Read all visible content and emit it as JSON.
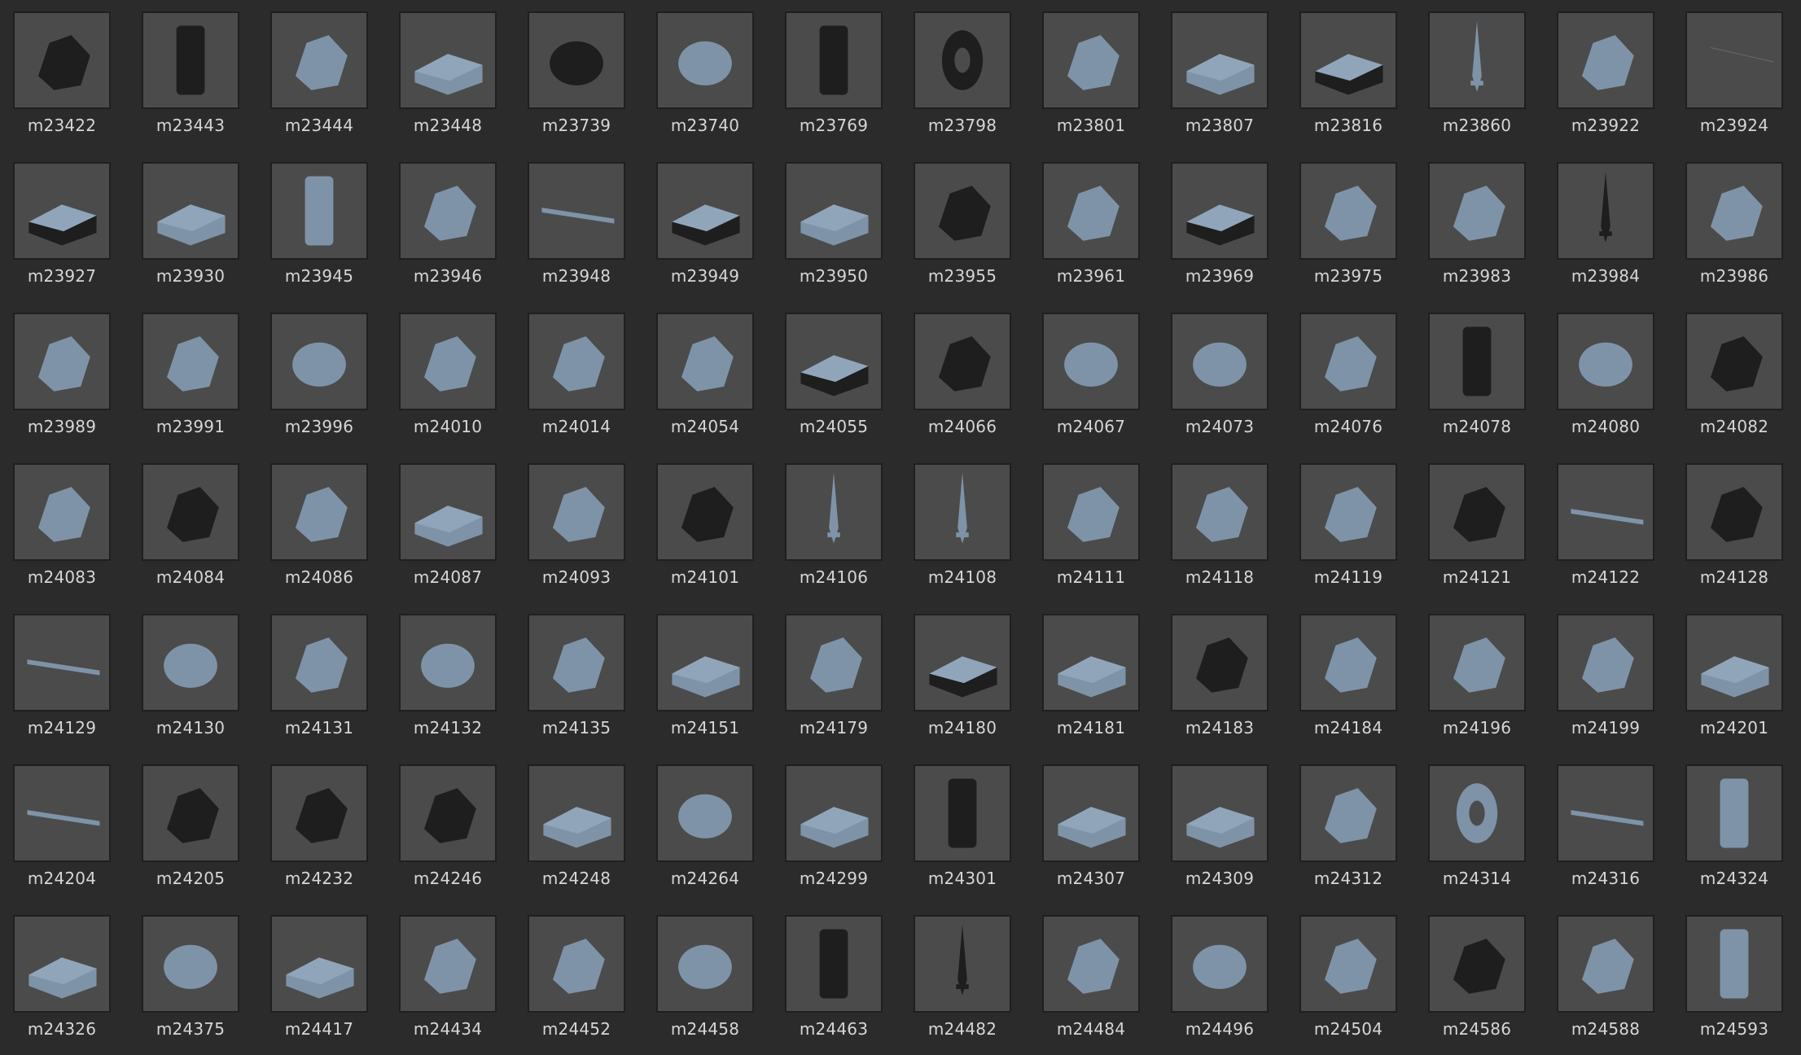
{
  "colors": {
    "background": "#2b2b2b",
    "thumb_bg": "#4b4b4b",
    "label": "#d6d6d6",
    "part_light": "#7f93a8",
    "part_dark": "#1e1e1e"
  },
  "items": [
    {
      "label": "m23422",
      "icon": "pin-connector-icon",
      "tone": "dark"
    },
    {
      "label": "m23443",
      "icon": "clip-holder-icon",
      "tone": "dark"
    },
    {
      "label": "m23444",
      "icon": "frame-bar-icon",
      "tone": "light"
    },
    {
      "label": "m23448",
      "icon": "curved-slope-icon",
      "tone": "light"
    },
    {
      "label": "m23739",
      "icon": "dome-cap-icon",
      "tone": "dark"
    },
    {
      "label": "m23740",
      "icon": "bowl-clip-icon",
      "tone": "light"
    },
    {
      "label": "m23769",
      "icon": "wrench-bar-icon",
      "tone": "dark"
    },
    {
      "label": "m23798",
      "icon": "tire-icon",
      "tone": "dark"
    },
    {
      "label": "m23801",
      "icon": "armor-piece-icon",
      "tone": "light"
    },
    {
      "label": "m23807",
      "icon": "machine-block-icon",
      "tone": "light"
    },
    {
      "label": "m23816",
      "icon": "brick-block-icon",
      "tone": "dark"
    },
    {
      "label": "m23860",
      "icon": "blade-icon",
      "tone": "light"
    },
    {
      "label": "m23922",
      "icon": "clamp-icon",
      "tone": "light"
    },
    {
      "label": "m23924",
      "icon": "empty-thumb-icon",
      "tone": "none"
    },
    {
      "label": "m23927",
      "icon": "vehicle-base-icon",
      "tone": "dark"
    },
    {
      "label": "m23930",
      "icon": "ramp-icon",
      "tone": "light"
    },
    {
      "label": "m23945",
      "icon": "column-icon",
      "tone": "light"
    },
    {
      "label": "m23946",
      "icon": "deer-icon",
      "tone": "light"
    },
    {
      "label": "m23948",
      "icon": "rod-icon",
      "tone": "light"
    },
    {
      "label": "m23949",
      "icon": "slope-brick-icon",
      "tone": "dark"
    },
    {
      "label": "m23950",
      "icon": "seat-icon",
      "tone": "light"
    },
    {
      "label": "m23955",
      "icon": "hair-piece-icon",
      "tone": "dark"
    },
    {
      "label": "m23961",
      "icon": "crane-arm-icon",
      "tone": "light"
    },
    {
      "label": "m23969",
      "icon": "box-corner-icon",
      "tone": "dark"
    },
    {
      "label": "m23975",
      "icon": "castle-wall-icon",
      "tone": "light"
    },
    {
      "label": "m23983",
      "icon": "bracket-icon",
      "tone": "light"
    },
    {
      "label": "m23984",
      "icon": "sword-dark-icon",
      "tone": "dark"
    },
    {
      "label": "m23986",
      "icon": "teapot-icon",
      "tone": "light"
    },
    {
      "label": "m23989",
      "icon": "wing-icon",
      "tone": "light"
    },
    {
      "label": "m23991",
      "icon": "boat-icon",
      "tone": "light"
    },
    {
      "label": "m23996",
      "icon": "rock-stairs-icon",
      "tone": "light"
    },
    {
      "label": "m24010",
      "icon": "mechanical-arm-icon",
      "tone": "light"
    },
    {
      "label": "m24014",
      "icon": "fist-icon",
      "tone": "light"
    },
    {
      "label": "m24054",
      "icon": "door-icon",
      "tone": "light"
    },
    {
      "label": "m24055",
      "icon": "plate-brick-icon",
      "tone": "dark"
    },
    {
      "label": "m24066",
      "icon": "skunk-icon",
      "tone": "dark"
    },
    {
      "label": "m24067",
      "icon": "helmet-round-icon",
      "tone": "light"
    },
    {
      "label": "m24073",
      "icon": "cap-icon",
      "tone": "light"
    },
    {
      "label": "m24076",
      "icon": "shark-icon",
      "tone": "light"
    },
    {
      "label": "m24078",
      "icon": "robot-torso-icon",
      "tone": "dark"
    },
    {
      "label": "m24080",
      "icon": "rock-icon",
      "tone": "light"
    },
    {
      "label": "m24082",
      "icon": "round-sign-icon",
      "tone": "dark"
    },
    {
      "label": "m24083",
      "icon": "dish-stand-icon",
      "tone": "light"
    },
    {
      "label": "m24084",
      "icon": "spiky-ball-icon",
      "tone": "dark"
    },
    {
      "label": "m24086",
      "icon": "net-icon",
      "tone": "light"
    },
    {
      "label": "m24087",
      "icon": "plate-round-icon",
      "tone": "light"
    },
    {
      "label": "m24093",
      "icon": "book-icon",
      "tone": "light"
    },
    {
      "label": "m24101",
      "icon": "chain-arm-icon",
      "tone": "dark"
    },
    {
      "label": "m24106",
      "icon": "sword-icon",
      "tone": "light"
    },
    {
      "label": "m24108",
      "icon": "sword-long-icon",
      "tone": "light"
    },
    {
      "label": "m24111",
      "icon": "pony-icon",
      "tone": "light"
    },
    {
      "label": "m24118",
      "icon": "hook-icon",
      "tone": "light"
    },
    {
      "label": "m24119",
      "icon": "gun-icon",
      "tone": "light"
    },
    {
      "label": "m24121",
      "icon": "track-curve-icon",
      "tone": "dark"
    },
    {
      "label": "m24122",
      "icon": "pipe-connector-icon",
      "tone": "light"
    },
    {
      "label": "m24128",
      "icon": "armor-dark-icon",
      "tone": "dark"
    },
    {
      "label": "m24129",
      "icon": "pipe-clip-icon",
      "tone": "light"
    },
    {
      "label": "m24130",
      "icon": "bowl-icon",
      "tone": "light"
    },
    {
      "label": "m24131",
      "icon": "pawn-icon",
      "tone": "light"
    },
    {
      "label": "m24132",
      "icon": "egg-icon",
      "tone": "light"
    },
    {
      "label": "m24135",
      "icon": "ring-clip-icon",
      "tone": "light"
    },
    {
      "label": "m24151",
      "icon": "wedge-plate-icon",
      "tone": "light"
    },
    {
      "label": "m24179",
      "icon": "cabin-icon",
      "tone": "light"
    },
    {
      "label": "m24180",
      "icon": "duplo-plate-icon",
      "tone": "dark"
    },
    {
      "label": "m24181",
      "icon": "flat-plate-icon",
      "tone": "light"
    },
    {
      "label": "m24183",
      "icon": "bear-icon",
      "tone": "dark"
    },
    {
      "label": "m24184",
      "icon": "tail-icon",
      "tone": "light"
    },
    {
      "label": "m24196",
      "icon": "fish-head-icon",
      "tone": "light"
    },
    {
      "label": "m24199",
      "icon": "lever-icon",
      "tone": "light"
    },
    {
      "label": "m24201",
      "icon": "slope-stud-icon",
      "tone": "light"
    },
    {
      "label": "m24204",
      "icon": "whip-icon",
      "tone": "light"
    },
    {
      "label": "m24205",
      "icon": "animal-dark-icon",
      "tone": "dark"
    },
    {
      "label": "m24232",
      "icon": "cannon-icon",
      "tone": "dark"
    },
    {
      "label": "m24246",
      "icon": "quarter-round-icon",
      "tone": "dark"
    },
    {
      "label": "m24248",
      "icon": "wedge-ramp-icon",
      "tone": "light"
    },
    {
      "label": "m24264",
      "icon": "turtle-icon",
      "tone": "light"
    },
    {
      "label": "m24299",
      "icon": "wing-plate-icon",
      "tone": "light"
    },
    {
      "label": "m24301",
      "icon": "tripod-icon",
      "tone": "dark"
    },
    {
      "label": "m24307",
      "icon": "stud-plate-icon",
      "tone": "light"
    },
    {
      "label": "m24309",
      "icon": "curved-slope-long-icon",
      "tone": "light"
    },
    {
      "label": "m24312",
      "icon": "chair-icon",
      "tone": "light"
    },
    {
      "label": "m24314",
      "icon": "wheel-icon",
      "tone": "light"
    },
    {
      "label": "m24316",
      "icon": "pipe-icon",
      "tone": "light"
    },
    {
      "label": "m24324",
      "icon": "post-icon",
      "tone": "light"
    },
    {
      "label": "m24326",
      "icon": "base-plate-icon",
      "tone": "light"
    },
    {
      "label": "m24375",
      "icon": "mushroom-icon",
      "tone": "light"
    },
    {
      "label": "m24417",
      "icon": "tread-plate-icon",
      "tone": "light"
    },
    {
      "label": "m24434",
      "icon": "arch-icon",
      "tone": "light"
    },
    {
      "label": "m24452",
      "icon": "cone-skirt-icon",
      "tone": "light"
    },
    {
      "label": "m24458",
      "icon": "umbrella-icon",
      "tone": "light"
    },
    {
      "label": "m24463",
      "icon": "figure-dark-icon",
      "tone": "dark"
    },
    {
      "label": "m24482",
      "icon": "spike-icon",
      "tone": "dark"
    },
    {
      "label": "m24484",
      "icon": "plant-icon",
      "tone": "light"
    },
    {
      "label": "m24496",
      "icon": "helmet-icon",
      "tone": "light"
    },
    {
      "label": "m24504",
      "icon": "boat-hull-icon",
      "tone": "light"
    },
    {
      "label": "m24586",
      "icon": "creature-dark-icon",
      "tone": "dark"
    },
    {
      "label": "m24588",
      "icon": "turret-icon",
      "tone": "light"
    },
    {
      "label": "m24593",
      "icon": "cylinder-icon",
      "tone": "light"
    }
  ]
}
